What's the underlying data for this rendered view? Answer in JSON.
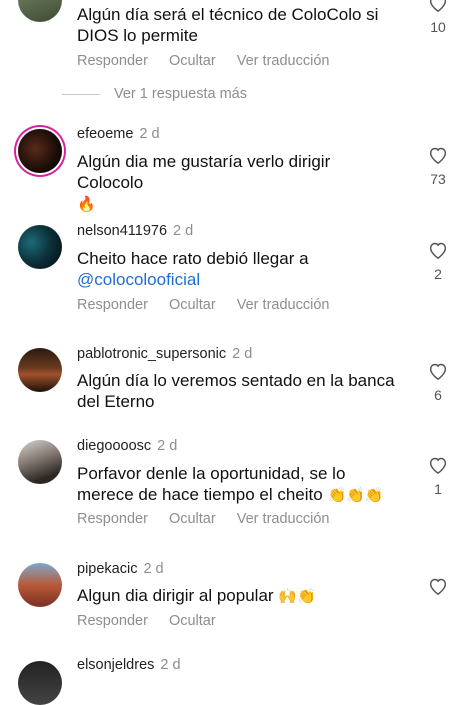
{
  "comments": [
    {
      "id": "c0",
      "username": "",
      "age": "",
      "text": "Algún día será el técnico de ColoColo si DIOS lo permite",
      "likes": "10",
      "actions": [
        "Responder",
        "Ocultar",
        "Ver traducción"
      ]
    },
    {
      "id": "c1",
      "username": "efeoeme",
      "age": "2 d",
      "text": "Algún dia me gustaría verlo dirigir Colocolo",
      "emoji": "🔥",
      "likes": "73",
      "actions": []
    },
    {
      "id": "c2",
      "username": "nelson411976",
      "age": "2 d",
      "text": "Cheito hace rato debió llegar a",
      "mention": "@colocolooficial",
      "likes": "2",
      "actions": [
        "Responder",
        "Ocultar",
        "Ver traducción"
      ]
    },
    {
      "id": "c3",
      "username": "pablotronic_supersonic",
      "age": "2 d",
      "text": "Algún día lo veremos sentado en la banca del Eterno",
      "likes": "6",
      "actions": []
    },
    {
      "id": "c4",
      "username": "diegoooosc",
      "age": "2 d",
      "text": "Porfavor denle la oportunidad, se lo merece de hace tiempo el cheito",
      "emoji": "👏👏👏",
      "likes": "1",
      "actions": [
        "Responder",
        "Ocultar",
        "Ver traducción"
      ]
    },
    {
      "id": "c5",
      "username": "pipekacic",
      "age": "2 d",
      "text": "Algun dia dirigir al popular",
      "emoji": "🙌👏",
      "likes": "",
      "actions": [
        "Responder",
        "Ocultar"
      ]
    },
    {
      "id": "c6",
      "username": "elsonjeldres",
      "age": "2 d",
      "text": "",
      "likes": "",
      "actions": []
    }
  ],
  "view_replies": "Ver 1 respuesta más",
  "colors": {
    "muted": "#8e8e8e",
    "link": "#1f6fd1",
    "story_ring": "#d6249f"
  }
}
